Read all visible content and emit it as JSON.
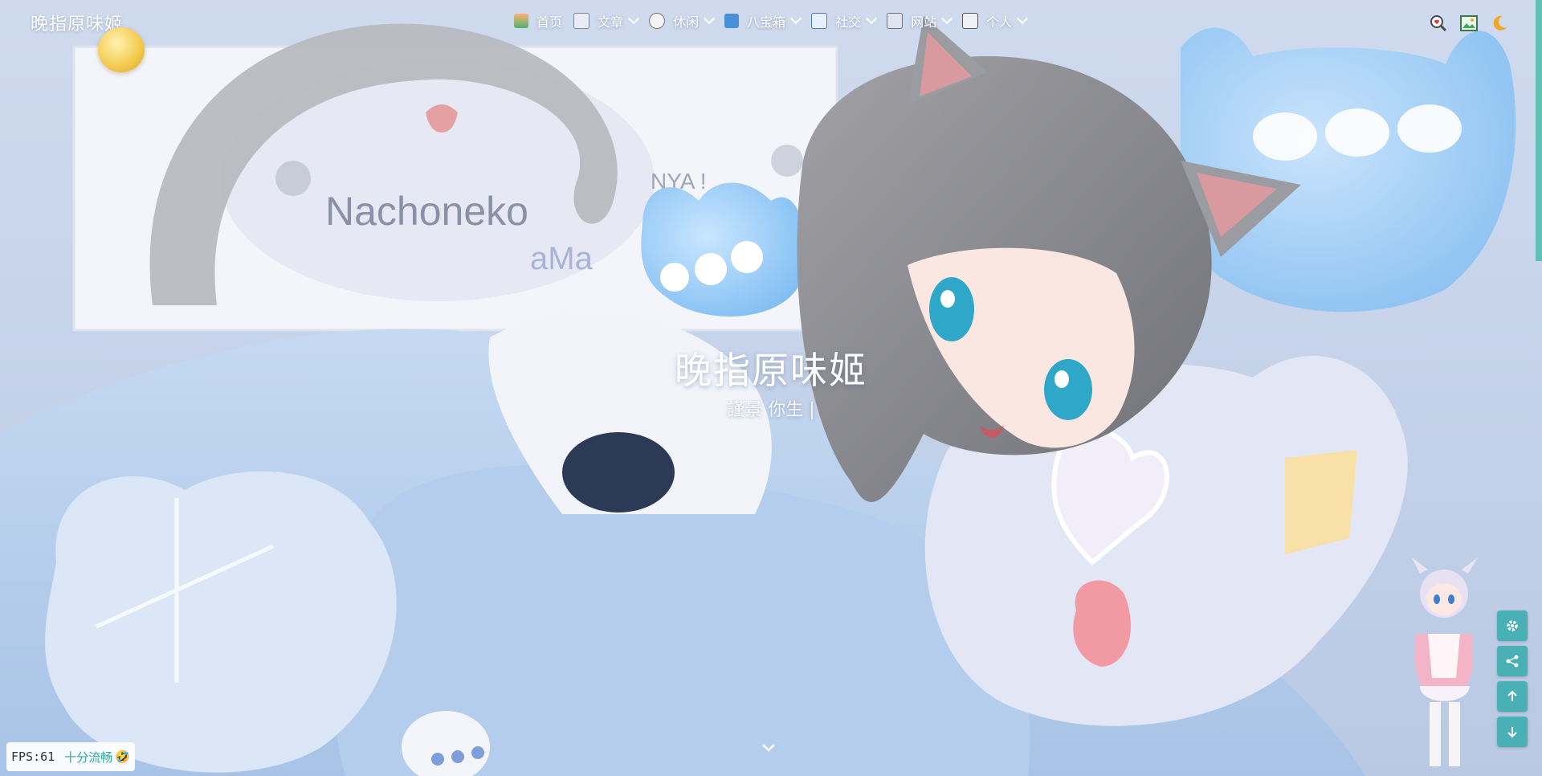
{
  "site": {
    "title": "晚指原味姬"
  },
  "nav": {
    "items": [
      {
        "label": "首页",
        "has_dropdown": false,
        "icon": "home-icon"
      },
      {
        "label": "文章",
        "has_dropdown": true,
        "icon": "book-icon"
      },
      {
        "label": "休闲",
        "has_dropdown": true,
        "icon": "cat-face-icon"
      },
      {
        "label": "八宝箱",
        "has_dropdown": true,
        "icon": "box-icon"
      },
      {
        "label": "社交",
        "has_dropdown": true,
        "icon": "chat-icon"
      },
      {
        "label": "网站",
        "has_dropdown": true,
        "icon": "website-icon"
      },
      {
        "label": "个人",
        "has_dropdown": true,
        "icon": "document-icon"
      }
    ]
  },
  "toolbar": {
    "search_icon": "search-heart-icon",
    "wallpaper_icon": "image-icon",
    "theme_icon": "moon-icon"
  },
  "hero": {
    "title": "晚指原味姬",
    "subtitle": "謹景 你生 |"
  },
  "side_buttons": [
    "gear-icon",
    "share-icon",
    "arrow-up-icon",
    "arrow-down-icon"
  ],
  "fps": {
    "label": "FPS:61",
    "status": "十分流畅",
    "emoji": "🤣"
  },
  "colors": {
    "accent": "#49b1b5",
    "fps_status": "#2ea7a0"
  }
}
